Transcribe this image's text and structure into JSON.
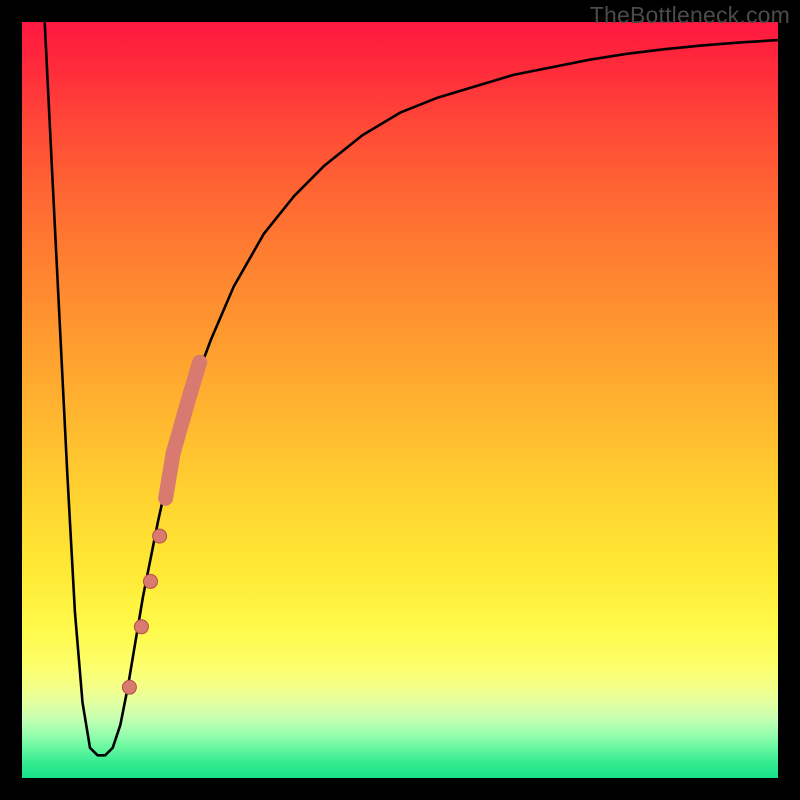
{
  "watermark": "TheBottleneck.com",
  "colors": {
    "frame": "#000000",
    "curve_stroke": "#000000",
    "dot_fill": "#d97a70",
    "dot_stroke": "#b24f46"
  },
  "chart_data": {
    "type": "line",
    "title": "",
    "xlabel": "",
    "ylabel": "",
    "xlim": [
      0,
      100
    ],
    "ylim": [
      0,
      100
    ],
    "axes_visible": false,
    "background": "vertical-gradient red→yellow→green",
    "series": [
      {
        "name": "bottleneck-curve",
        "x": [
          3,
          4,
          5,
          6,
          7,
          8,
          9,
          10,
          11,
          12,
          13,
          14,
          15,
          16,
          18,
          20,
          22,
          25,
          28,
          32,
          36,
          40,
          45,
          50,
          55,
          60,
          65,
          70,
          75,
          80,
          85,
          90,
          95,
          100
        ],
        "values": [
          100,
          80,
          60,
          40,
          22,
          10,
          4,
          3,
          3,
          4,
          7,
          12,
          18,
          24,
          34,
          43,
          50,
          58,
          65,
          72,
          77,
          81,
          85,
          88,
          90,
          91.5,
          93,
          94,
          95,
          95.8,
          96.4,
          96.9,
          97.3,
          97.6
        ]
      }
    ],
    "markers": [
      {
        "name": "highlight-dot",
        "x": 14.2,
        "y": 12
      },
      {
        "name": "highlight-dot",
        "x": 15.8,
        "y": 20
      },
      {
        "name": "highlight-dot",
        "x": 17.0,
        "y": 26
      },
      {
        "name": "highlight-dot",
        "x": 18.2,
        "y": 32
      },
      {
        "name": "highlight-segment-start",
        "x": 19.0,
        "y": 37
      },
      {
        "name": "highlight-segment-end",
        "x": 23.5,
        "y": 55
      }
    ]
  }
}
